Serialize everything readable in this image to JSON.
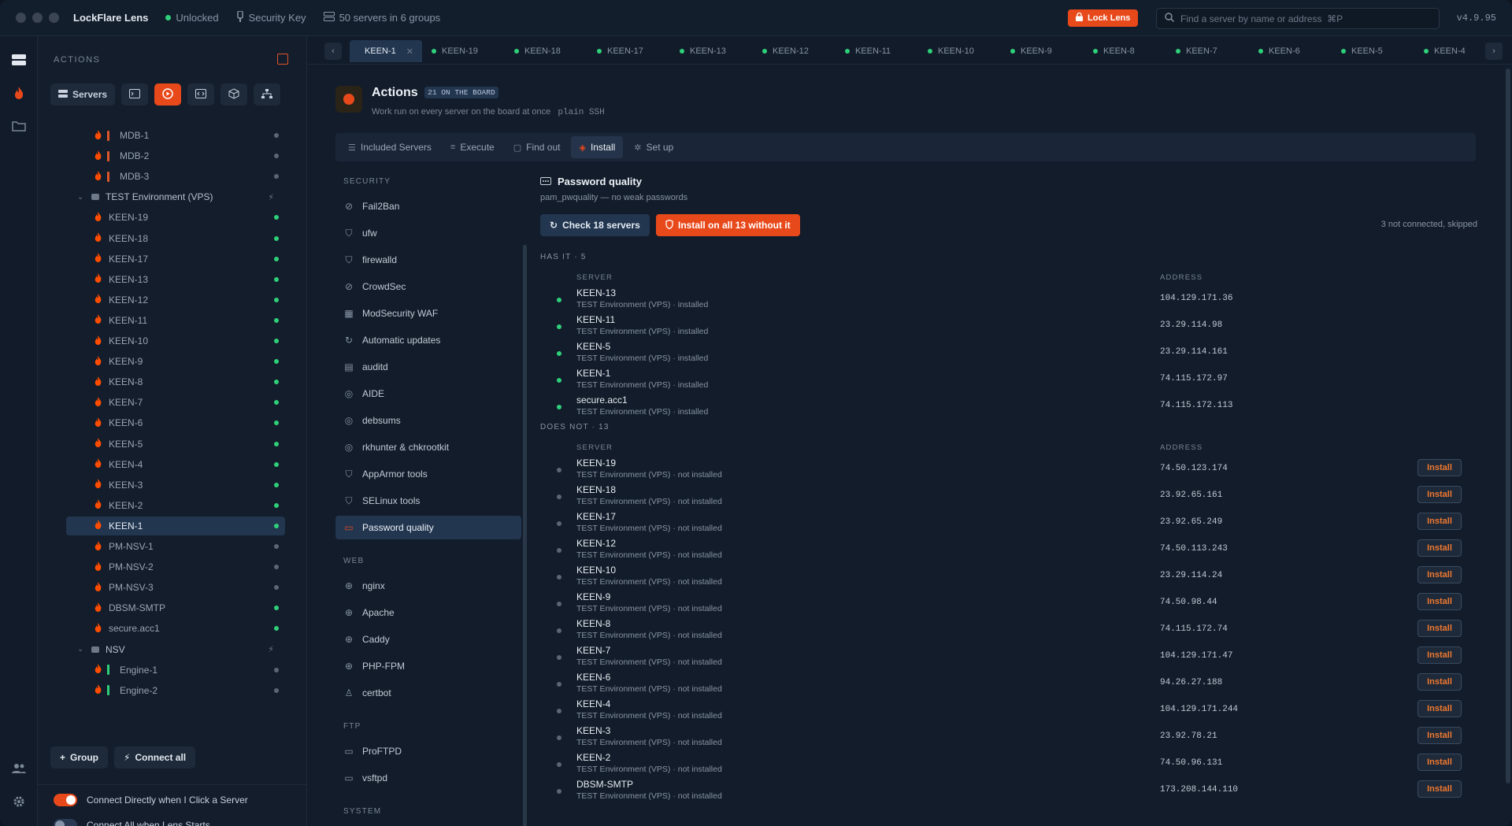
{
  "app": {
    "title": "LockFlare Lens",
    "status": "Unlocked",
    "security_key": "Security Key",
    "servers_summary": "50 servers in 6 groups",
    "lock_button": "Lock Lens",
    "search_placeholder": "Find a server by name or address  ⌘P",
    "version": "v4.9.95"
  },
  "sidebar": {
    "heading": "ACTIONS",
    "servers_button": "Servers",
    "tree": [
      {
        "type": "server",
        "name": "MDB-1",
        "bar": "#e0562a",
        "status": "grey"
      },
      {
        "type": "server",
        "name": "MDB-2",
        "bar": "#e0562a",
        "status": "grey"
      },
      {
        "type": "server",
        "name": "MDB-3",
        "bar": "#e0562a",
        "status": "grey"
      },
      {
        "type": "group",
        "name": "TEST Environment (VPS)"
      },
      {
        "type": "server",
        "name": "KEEN-19",
        "status": "green"
      },
      {
        "type": "server",
        "name": "KEEN-18",
        "status": "green"
      },
      {
        "type": "server",
        "name": "KEEN-17",
        "status": "green"
      },
      {
        "type": "server",
        "name": "KEEN-13",
        "status": "green"
      },
      {
        "type": "server",
        "name": "KEEN-12",
        "status": "green"
      },
      {
        "type": "server",
        "name": "KEEN-11",
        "status": "green"
      },
      {
        "type": "server",
        "name": "KEEN-10",
        "status": "green"
      },
      {
        "type": "server",
        "name": "KEEN-9",
        "status": "green"
      },
      {
        "type": "server",
        "name": "KEEN-8",
        "status": "green"
      },
      {
        "type": "server",
        "name": "KEEN-7",
        "status": "green"
      },
      {
        "type": "server",
        "name": "KEEN-6",
        "status": "green"
      },
      {
        "type": "server",
        "name": "KEEN-5",
        "status": "green"
      },
      {
        "type": "server",
        "name": "KEEN-4",
        "status": "green"
      },
      {
        "type": "server",
        "name": "KEEN-3",
        "status": "green"
      },
      {
        "type": "server",
        "name": "KEEN-2",
        "status": "green"
      },
      {
        "type": "server",
        "name": "KEEN-1",
        "status": "green",
        "selected": true
      },
      {
        "type": "server",
        "name": "PM-NSV-1",
        "status": "grey"
      },
      {
        "type": "server",
        "name": "PM-NSV-2",
        "status": "grey"
      },
      {
        "type": "server",
        "name": "PM-NSV-3",
        "status": "grey"
      },
      {
        "type": "server",
        "name": "DBSM-SMTP",
        "status": "green"
      },
      {
        "type": "server",
        "name": "secure.acc1",
        "status": "green"
      },
      {
        "type": "group",
        "name": "NSV"
      },
      {
        "type": "server",
        "name": "Engine-1",
        "bar": "#2fd07a",
        "status": "grey"
      },
      {
        "type": "server",
        "name": "Engine-2",
        "bar": "#2fd07a",
        "status": "grey"
      }
    ],
    "group_button": "Group",
    "connect_all_button": "Connect all",
    "toggle_connect_direct": "Connect Directly when I Click a Server",
    "toggle_connect_start": "Connect All when Lens Starts"
  },
  "tabs": [
    "KEEN-1",
    "KEEN-19",
    "KEEN-18",
    "KEEN-17",
    "KEEN-13",
    "KEEN-12",
    "KEEN-11",
    "KEEN-10",
    "KEEN-9",
    "KEEN-8",
    "KEEN-7",
    "KEEN-6",
    "KEEN-5",
    "KEEN-4"
  ],
  "actions": {
    "title": "Actions",
    "badge": "21 ON THE BOARD",
    "subtitle": "Work run on every server on the board at once",
    "mode": "plain SSH",
    "subtabs": [
      {
        "label": "Included Servers",
        "icon": "☰"
      },
      {
        "label": "Execute",
        "icon": "≡"
      },
      {
        "label": "Find out",
        "icon": "▢"
      },
      {
        "label": "Install",
        "icon": "◈",
        "active": true
      },
      {
        "label": "Set up",
        "icon": "✲"
      }
    ]
  },
  "categories": [
    {
      "head": "SECURITY"
    },
    {
      "label": "Fail2Ban",
      "icon": "⊘"
    },
    {
      "label": "ufw",
      "icon": "⛉"
    },
    {
      "label": "firewalld",
      "icon": "⛉"
    },
    {
      "label": "CrowdSec",
      "icon": "⊘"
    },
    {
      "label": "ModSecurity WAF",
      "icon": "▦"
    },
    {
      "label": "Automatic updates",
      "icon": "↻"
    },
    {
      "label": "auditd",
      "icon": "▤"
    },
    {
      "label": "AIDE",
      "icon": "◎"
    },
    {
      "label": "debsums",
      "icon": "◎"
    },
    {
      "label": "rkhunter & chkrootkit",
      "icon": "◎"
    },
    {
      "label": "AppArmor tools",
      "icon": "⛉"
    },
    {
      "label": "SELinux tools",
      "icon": "⛉"
    },
    {
      "label": "Password quality",
      "icon": "▭",
      "active": true
    },
    {
      "head": "WEB"
    },
    {
      "label": "nginx",
      "icon": "⊕"
    },
    {
      "label": "Apache",
      "icon": "⊕"
    },
    {
      "label": "Caddy",
      "icon": "⊕"
    },
    {
      "label": "PHP-FPM",
      "icon": "⊕"
    },
    {
      "label": "certbot",
      "icon": "♙"
    },
    {
      "head": "FTP"
    },
    {
      "label": "ProFTPD",
      "icon": "▭"
    },
    {
      "label": "vsftpd",
      "icon": "▭"
    },
    {
      "head": "SYSTEM"
    }
  ],
  "detail": {
    "title": "Password quality",
    "subtitle": "pam_pwquality — no weak passwords",
    "check_button": "Check 18 servers",
    "install_all_button": "Install on all 13 without it",
    "skipped": "3 not connected, skipped",
    "has_head": "HAS IT · 5",
    "not_head": "DOES NOT · 13",
    "col_server": "SERVER",
    "col_address": "ADDRESS",
    "install_label": "Install",
    "has": [
      {
        "name": "KEEN-13",
        "group": "TEST Environment (VPS) · installed",
        "address": "104.129.171.36"
      },
      {
        "name": "KEEN-11",
        "group": "TEST Environment (VPS) · installed",
        "address": "23.29.114.98"
      },
      {
        "name": "KEEN-5",
        "group": "TEST Environment (VPS) · installed",
        "address": "23.29.114.161"
      },
      {
        "name": "KEEN-1",
        "group": "TEST Environment (VPS) · installed",
        "address": "74.115.172.97"
      },
      {
        "name": "secure.acc1",
        "group": "TEST Environment (VPS) · installed",
        "address": "74.115.172.113"
      }
    ],
    "not": [
      {
        "name": "KEEN-19",
        "group": "TEST Environment (VPS) · not installed",
        "address": "74.50.123.174"
      },
      {
        "name": "KEEN-18",
        "group": "TEST Environment (VPS) · not installed",
        "address": "23.92.65.161"
      },
      {
        "name": "KEEN-17",
        "group": "TEST Environment (VPS) · not installed",
        "address": "23.92.65.249"
      },
      {
        "name": "KEEN-12",
        "group": "TEST Environment (VPS) · not installed",
        "address": "74.50.113.243"
      },
      {
        "name": "KEEN-10",
        "group": "TEST Environment (VPS) · not installed",
        "address": "23.29.114.24"
      },
      {
        "name": "KEEN-9",
        "group": "TEST Environment (VPS) · not installed",
        "address": "74.50.98.44"
      },
      {
        "name": "KEEN-8",
        "group": "TEST Environment (VPS) · not installed",
        "address": "74.115.172.74"
      },
      {
        "name": "KEEN-7",
        "group": "TEST Environment (VPS) · not installed",
        "address": "104.129.171.47"
      },
      {
        "name": "KEEN-6",
        "group": "TEST Environment (VPS) · not installed",
        "address": "94.26.27.188"
      },
      {
        "name": "KEEN-4",
        "group": "TEST Environment (VPS) · not installed",
        "address": "104.129.171.244"
      },
      {
        "name": "KEEN-3",
        "group": "TEST Environment (VPS) · not installed",
        "address": "23.92.78.21"
      },
      {
        "name": "KEEN-2",
        "group": "TEST Environment (VPS) · not installed",
        "address": "74.50.96.131"
      },
      {
        "name": "DBSM-SMTP",
        "group": "TEST Environment (VPS) · not installed",
        "address": "173.208.144.110"
      }
    ]
  },
  "colors": {
    "accent": "#e8491b",
    "online": "#2fd07a",
    "offline": "#5b6676",
    "selected": "#223650"
  }
}
